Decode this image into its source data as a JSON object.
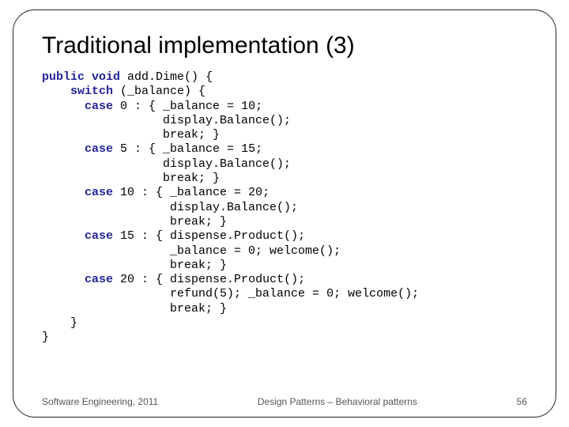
{
  "title": "Traditional implementation (3)",
  "code": {
    "kw_public": "public",
    "kw_void": "void",
    "fn_name": " add.Dime() {",
    "kw_switch": "switch",
    "switch_expr": " (_balance) {",
    "kw_case": "case",
    "c0": {
      "label": " 0 : { ",
      "l1": "_balance = 10;",
      "l2": "display.Balance();",
      "l3": "break; }"
    },
    "c5": {
      "label": " 5 : { ",
      "l1": "_balance = 15;",
      "l2": "display.Balance();",
      "l3": "break; }"
    },
    "c10": {
      "label": " 10 : { ",
      "l1": "_balance = 20;",
      "l2": "display.Balance();",
      "l3": "break; }"
    },
    "c15": {
      "label": " 15 : { ",
      "l1": "dispense.Product();",
      "l2": "_balance = 0; welcome();",
      "l3": "break; }"
    },
    "c20": {
      "label": " 20 : { ",
      "l1": "dispense.Product();",
      "l2": "refund(5); _balance = 0; welcome();",
      "l3": "break; }"
    },
    "close1": "    }",
    "close2": "}"
  },
  "footer": {
    "left": "Software Engineering, 2011",
    "center": "Design Patterns – Behavioral patterns",
    "page": "56"
  }
}
